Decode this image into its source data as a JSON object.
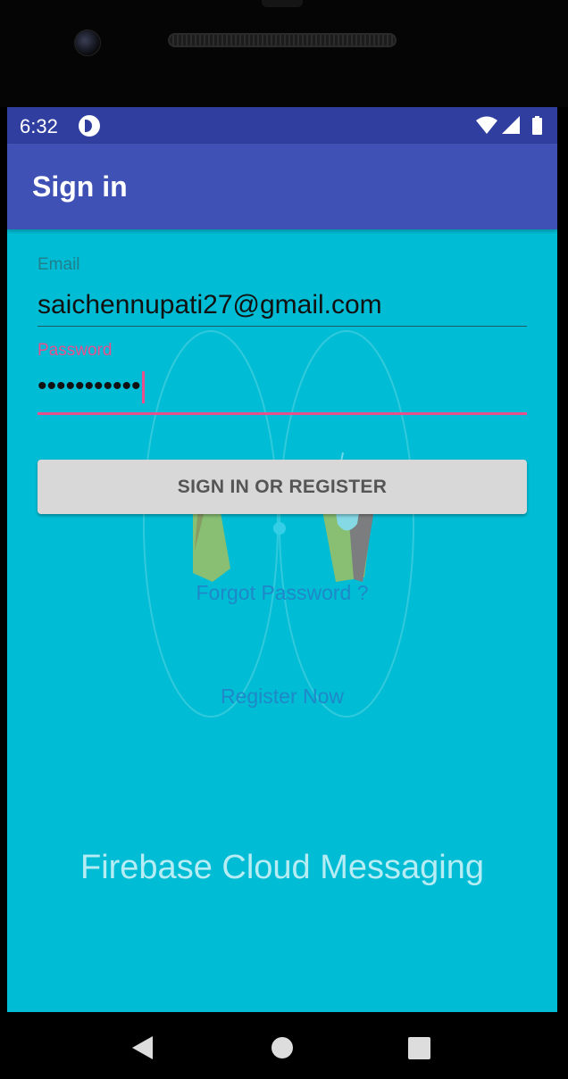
{
  "status_bar": {
    "time": "6:32",
    "icons": [
      "app-notification-icon",
      "wifi-icon",
      "signal-icon",
      "battery-icon"
    ]
  },
  "app_bar": {
    "title": "Sign in"
  },
  "form": {
    "email": {
      "label": "Email",
      "value": "saichennupati27@gmail.com"
    },
    "password": {
      "label": "Password",
      "value": "•••••••••••"
    },
    "submit_label": "SIGN IN OR REGISTER"
  },
  "links": {
    "forgot_password": "Forgot Password ?",
    "register_now": "Register Now"
  },
  "background": {
    "logo_text": "Firebase Cloud Messaging"
  },
  "nav_bar": {
    "buttons": [
      "back",
      "home",
      "recents"
    ]
  },
  "colors": {
    "status_bar": "#303F9F",
    "app_bar": "#3F51B5",
    "background": "#00BCD4",
    "accent": "#E84F8C",
    "button": "#D8D8D8",
    "link": "#1E88C8"
  }
}
